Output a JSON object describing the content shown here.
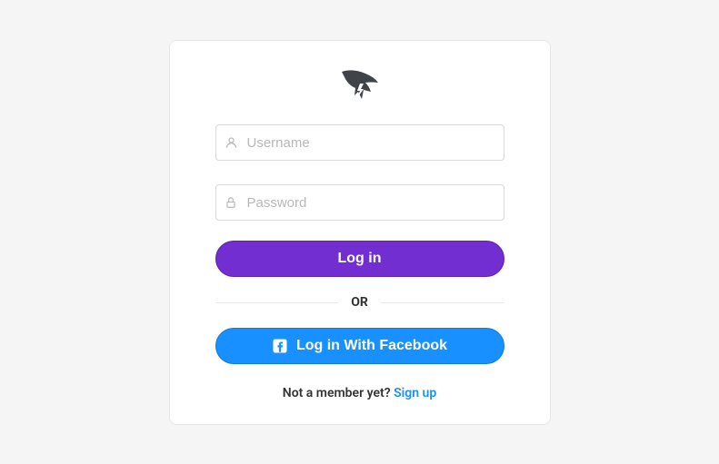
{
  "form": {
    "username_placeholder": "Username",
    "password_placeholder": "Password",
    "login_button": "Log in",
    "divider": "OR",
    "facebook_button": "Log in With Facebook"
  },
  "footer": {
    "prompt": "Not a member yet? ",
    "link": "Sign up"
  },
  "colors": {
    "primary": "#722ed1",
    "facebook": "#1890ff",
    "link": "#1890ff"
  }
}
